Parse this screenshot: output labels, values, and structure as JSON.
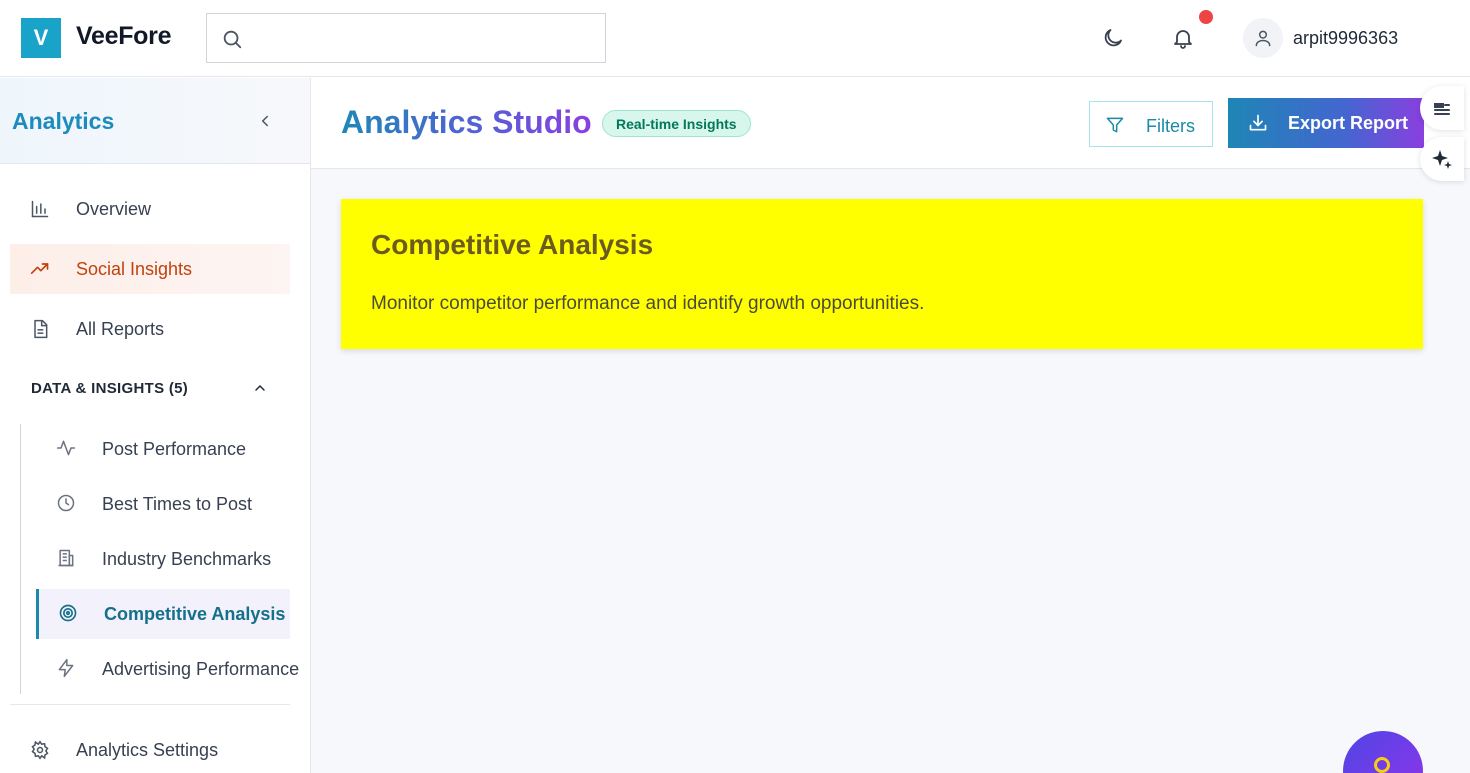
{
  "app": {
    "logo_letter": "V",
    "name": "VeeFore"
  },
  "header": {
    "search": {
      "placeholder": "",
      "icon": "search-icon"
    },
    "theme_icon": "moon-icon",
    "notification_icon": "bell-icon",
    "user": {
      "name": "arpit9996363",
      "icon": "user-icon"
    }
  },
  "sidebar": {
    "title": "Analytics",
    "items": [
      {
        "label": "Overview",
        "icon": "bar-chart-icon"
      },
      {
        "label": "Social Insights",
        "icon": "trending-up-icon",
        "active": true
      },
      {
        "label": "All Reports",
        "icon": "file-text-icon"
      }
    ],
    "section": {
      "title": "DATA & INSIGHTS (5)",
      "expanded": true,
      "items": [
        {
          "label": "Post Performance",
          "icon": "activity-icon"
        },
        {
          "label": "Best Times to Post",
          "icon": "clock-icon"
        },
        {
          "label": "Industry Benchmarks",
          "icon": "building-icon"
        },
        {
          "label": "Competitive Analysis",
          "icon": "target-icon",
          "active": true
        },
        {
          "label": "Advertising Performance",
          "icon": "zap-icon"
        }
      ]
    },
    "footer_item": {
      "label": "Analytics Settings",
      "icon": "gear-icon"
    }
  },
  "main": {
    "title": "Analytics Studio",
    "badge": "Real-time Insights",
    "filters_label": "Filters",
    "export_label": "Export Report",
    "card": {
      "title": "Competitive Analysis",
      "description": "Monitor competitor performance and identify growth opportunities."
    }
  },
  "colors": {
    "brand": "#1aa3c8",
    "active_nav": "#c2410c",
    "active_sub": "#15708a",
    "card_bg": "#ffff00",
    "notification": "#ef4444"
  }
}
